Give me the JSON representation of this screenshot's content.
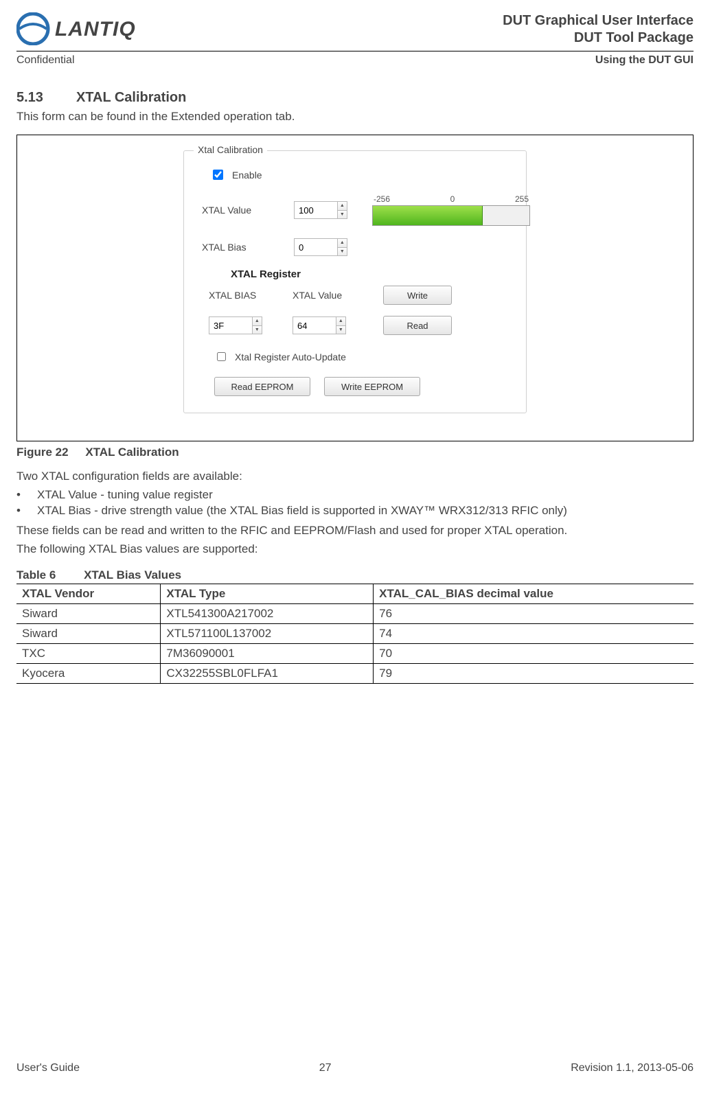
{
  "header": {
    "logo_text": "LANTIQ",
    "title1": "DUT Graphical User Interface",
    "title2": "DUT Tool Package",
    "left_sub": "Confidential",
    "right_sub": "Using the DUT GUI"
  },
  "section": {
    "number": "5.13",
    "title": "XTAL Calibration",
    "intro": "This form can be found in the Extended operation tab."
  },
  "gui": {
    "group_title": "Xtal Calibration",
    "enable_label": "Enable",
    "enable_checked": true,
    "xtal_value_label": "XTAL Value",
    "xtal_value": "100",
    "xtal_bias_label": "XTAL Bias",
    "xtal_bias": "0",
    "scale": {
      "min": "-256",
      "mid": "0",
      "max": "255"
    },
    "reg_title": "XTAL Register",
    "reg_bias_label": "XTAL BIAS",
    "reg_value_label": "XTAL Value",
    "reg_bias": "3F",
    "reg_value": "64",
    "write_btn": "Write",
    "read_btn": "Read",
    "auto_label": "Xtal Register Auto-Update",
    "auto_checked": false,
    "read_eeprom_btn": "Read EEPROM",
    "write_eeprom_btn": "Write EEPROM"
  },
  "figure": {
    "num": "Figure 22",
    "title": "XTAL Calibration"
  },
  "body": {
    "p1": "Two XTAL configuration fields are available:",
    "b1": "XTAL Value - tuning value register",
    "b2": "XTAL Bias - drive strength value (the XTAL Bias field is supported in XWAY™ WRX312/313 RFIC only)",
    "p2": "These fields can be read and written to the RFIC and EEPROM/Flash and used for proper XTAL operation.",
    "p3": "The following XTAL Bias values are supported:"
  },
  "table": {
    "num": "Table 6",
    "title": "XTAL Bias Values",
    "headers": [
      "XTAL Vendor",
      "XTAL Type",
      "XTAL_CAL_BIAS decimal value"
    ],
    "rows": [
      [
        "Siward",
        "XTL541300A217002",
        "76"
      ],
      [
        "Siward",
        "XTL571100L137002",
        "74"
      ],
      [
        "TXC",
        "7M36090001",
        "70"
      ],
      [
        "Kyocera",
        "CX32255SBL0FLFA1",
        "79"
      ]
    ]
  },
  "footer": {
    "left": "User's Guide",
    "center": "27",
    "right": "Revision 1.1, 2013-05-06"
  }
}
